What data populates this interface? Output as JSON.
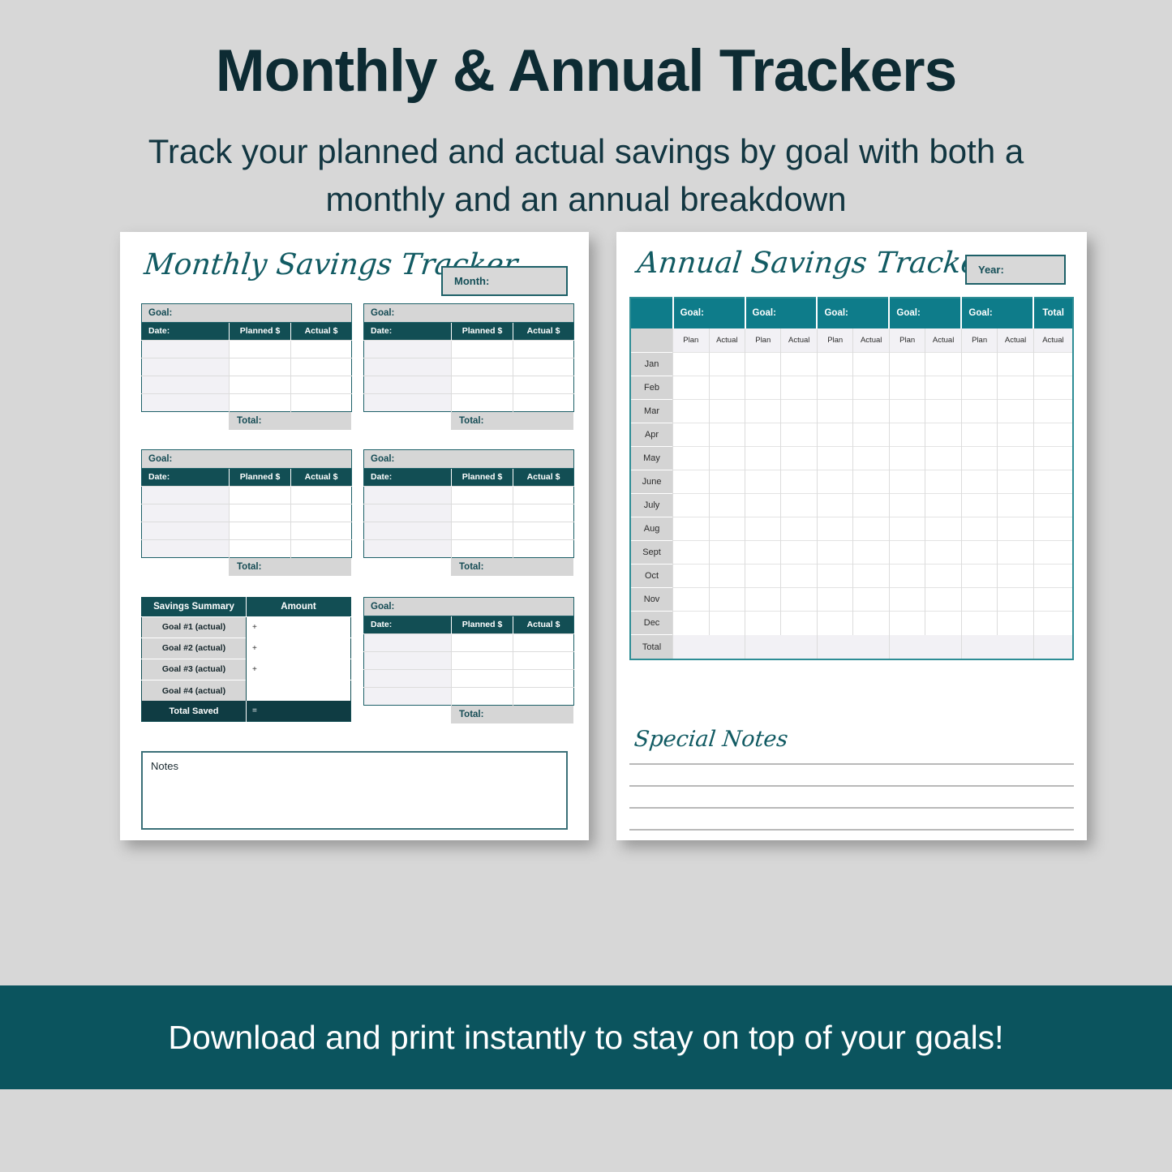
{
  "header": {
    "title": "Monthly & Annual Trackers",
    "subtitle": "Track your planned and actual savings by goal with both a monthly and an annual breakdown"
  },
  "colors": {
    "background": "#d7d7d7",
    "dark_teal": "#124e54",
    "bright_teal": "#0e7c8a",
    "banner_teal": "#0b545e",
    "title_navy": "#0d2b33",
    "gray_fill": "#d6d6d6",
    "row_tint": "#f2f1f5"
  },
  "monthly_sheet": {
    "title": "Monthly Savings Tracker",
    "month_label": "Month:",
    "goal_table": {
      "goal_label": "Goal:",
      "date_header": "Date:",
      "planned_header": "Planned $",
      "actual_header": "Actual $",
      "total_label": "Total:",
      "row_count": 4
    },
    "goal_blocks": [
      {
        "goal_label": "Goal:"
      },
      {
        "goal_label": "Goal:"
      },
      {
        "goal_label": "Goal:"
      },
      {
        "goal_label": "Goal:"
      },
      {
        "goal_label": "Goal:"
      }
    ],
    "summary": {
      "header_left": "Savings Summary",
      "header_right": "Amount",
      "rows": [
        {
          "label": "Goal #1 (actual)",
          "amount": "+"
        },
        {
          "label": "Goal #2 (actual)",
          "amount": "+"
        },
        {
          "label": "Goal #3 (actual)",
          "amount": "+"
        },
        {
          "label": "Goal #4 (actual)",
          "amount": ""
        }
      ],
      "total_label": "Total Saved",
      "total_amount": "="
    },
    "notes_label": "Notes"
  },
  "annual_sheet": {
    "title": "Annual Savings Tracker",
    "year_label": "Year:",
    "goal_headers": [
      "Goal:",
      "Goal:",
      "Goal:",
      "Goal:",
      "Goal:"
    ],
    "total_header": "Total",
    "sub_headers": [
      "Plan",
      "Actual"
    ],
    "total_sub_header": "Actual",
    "months": [
      "Jan",
      "Feb",
      "Mar",
      "Apr",
      "May",
      "June",
      "July",
      "Aug",
      "Sept",
      "Oct",
      "Nov",
      "Dec"
    ],
    "total_row_label": "Total",
    "special_notes": {
      "title": "Special Notes",
      "line_count": 4
    }
  },
  "footer": {
    "message": "Download and print instantly to stay on top of your goals!"
  }
}
